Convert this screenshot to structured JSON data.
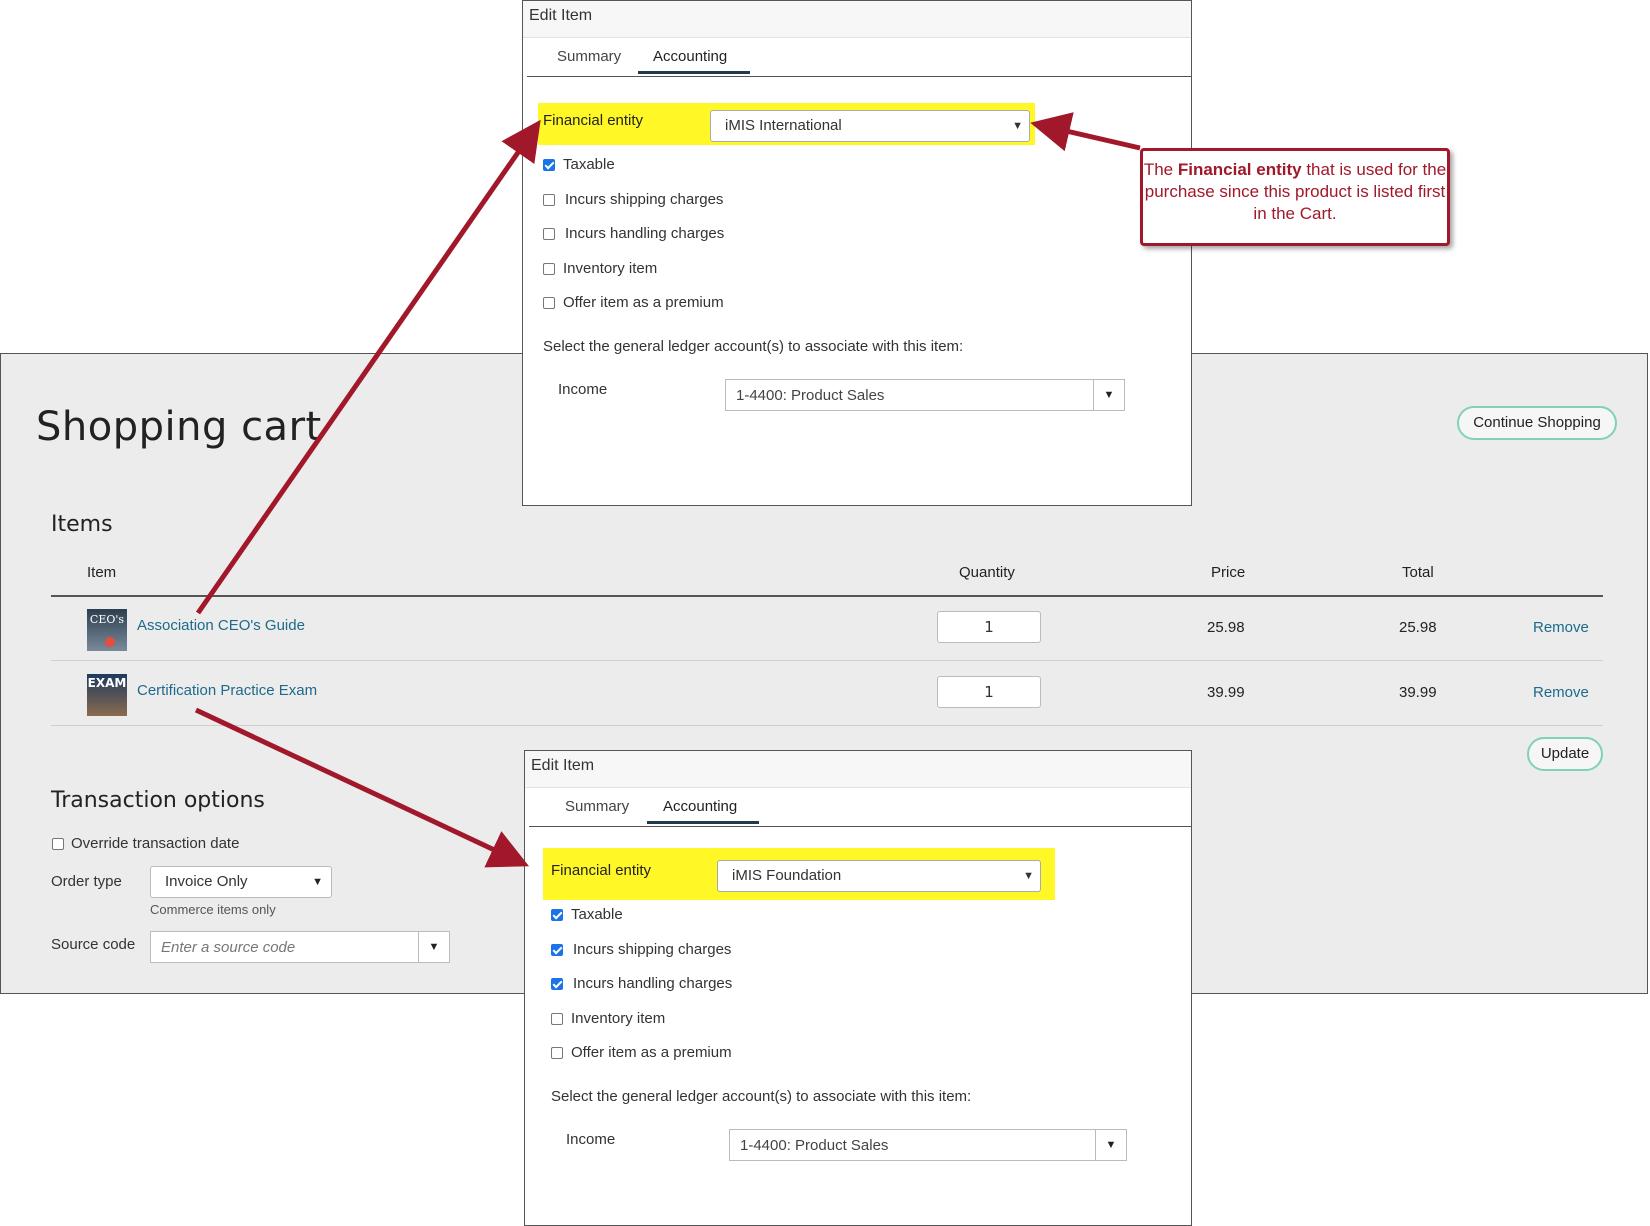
{
  "cart": {
    "title": "Shopping cart",
    "continue_label": "Continue Shopping",
    "items_heading": "Items",
    "columns": {
      "item": "Item",
      "quantity": "Quantity",
      "price": "Price",
      "total": "Total"
    },
    "rows": [
      {
        "name": "Association CEO's Guide",
        "quantity": "1",
        "price": "25.98",
        "total": "25.98",
        "remove": "Remove",
        "thumb_text": "CEO's"
      },
      {
        "name": "Certification Practice Exam",
        "quantity": "1",
        "price": "39.99",
        "total": "39.99",
        "remove": "Remove",
        "thumb_text": "EXAM"
      }
    ],
    "update_label": "Update",
    "transaction_heading": "Transaction options",
    "override_label": "Override transaction date",
    "order_type_label": "Order type",
    "order_type_value": "Invoice Only",
    "order_type_hint": "Commerce items only",
    "source_code_label": "Source code",
    "source_code_placeholder": "Enter a source code"
  },
  "dialog_top": {
    "title": "Edit Item",
    "tabs": [
      "Summary",
      "Accounting"
    ],
    "financial_entity_label": "Financial entity",
    "financial_entity_value": "iMIS International",
    "checkboxes": [
      {
        "label": "Taxable",
        "checked": true
      },
      {
        "label": "Incurs shipping charges",
        "checked": false
      },
      {
        "label": "Incurs handling charges",
        "checked": false
      },
      {
        "label": "Inventory item",
        "checked": false
      },
      {
        "label": "Offer item as a premium",
        "checked": false
      }
    ],
    "gl_prompt": "Select the general ledger account(s) to associate with this item:",
    "income_label": "Income",
    "income_value": "1-4400: Product Sales"
  },
  "dialog_bottom": {
    "title": "Edit Item",
    "tabs": [
      "Summary",
      "Accounting"
    ],
    "financial_entity_label": "Financial entity",
    "financial_entity_value": "iMIS Foundation",
    "checkboxes": [
      {
        "label": "Taxable",
        "checked": true
      },
      {
        "label": "Incurs shipping charges",
        "checked": true
      },
      {
        "label": "Incurs handling charges",
        "checked": true
      },
      {
        "label": "Inventory item",
        "checked": false
      },
      {
        "label": "Offer item as a premium",
        "checked": false
      }
    ],
    "gl_prompt": "Select the general ledger account(s) to associate with this item:",
    "income_label": "Income",
    "income_value": "1-4400: Product Sales"
  },
  "callout": {
    "pre": "The ",
    "bold": "Financial entity",
    "post": " that is used for the purchase since this product is listed first in the Cart."
  },
  "colors": {
    "arrow": "#a0182a",
    "highlight": "#fff700",
    "link": "#1d6a8a",
    "pill_border": "#7fd3b2",
    "checkbox_on": "#1a73e8"
  }
}
